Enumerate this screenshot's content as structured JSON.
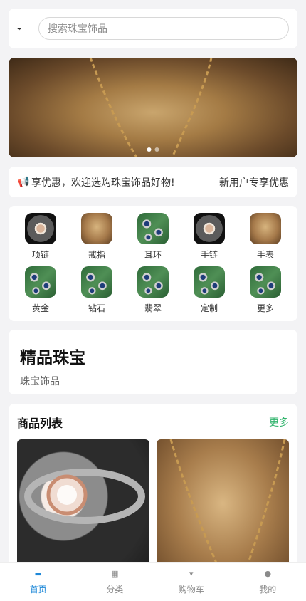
{
  "search": {
    "placeholder": "搜索珠宝饰品",
    "logo_glyph": "⌁"
  },
  "banner": {
    "dots": 2,
    "active_dot": 0
  },
  "notice": {
    "icon": "speaker-icon",
    "text": "享优惠，欢迎选购珠宝饰品好物!",
    "promo": "新用户专享优惠"
  },
  "categories": {
    "row1": [
      {
        "label": "项链",
        "thumb": "ring"
      },
      {
        "label": "戒指",
        "thumb": "chain"
      },
      {
        "label": "耳环",
        "thumb": "jade"
      },
      {
        "label": "手链",
        "thumb": "ring"
      },
      {
        "label": "手表",
        "thumb": "chain"
      }
    ],
    "row2": [
      {
        "label": "黄金",
        "thumb": "jade"
      },
      {
        "label": "钻石",
        "thumb": "jade"
      },
      {
        "label": "翡翠",
        "thumb": "jade"
      },
      {
        "label": "定制",
        "thumb": "jade"
      },
      {
        "label": "更多",
        "thumb": "jade"
      }
    ]
  },
  "featured": {
    "title": "精品珠宝",
    "subtitle": "珠宝饰品"
  },
  "products": {
    "title": "商品列表",
    "more": "更多"
  },
  "tabbar": {
    "items": [
      {
        "label": "首页",
        "icon": "home-icon",
        "active": true
      },
      {
        "label": "分类",
        "icon": "grid-icon",
        "active": false
      },
      {
        "label": "购物车",
        "icon": "cart-icon",
        "active": false
      },
      {
        "label": "我的",
        "icon": "user-icon",
        "active": false
      }
    ]
  },
  "colors": {
    "accent": "#1e88d8",
    "more_link": "#2fb36b",
    "background": "#f3f3f5"
  }
}
